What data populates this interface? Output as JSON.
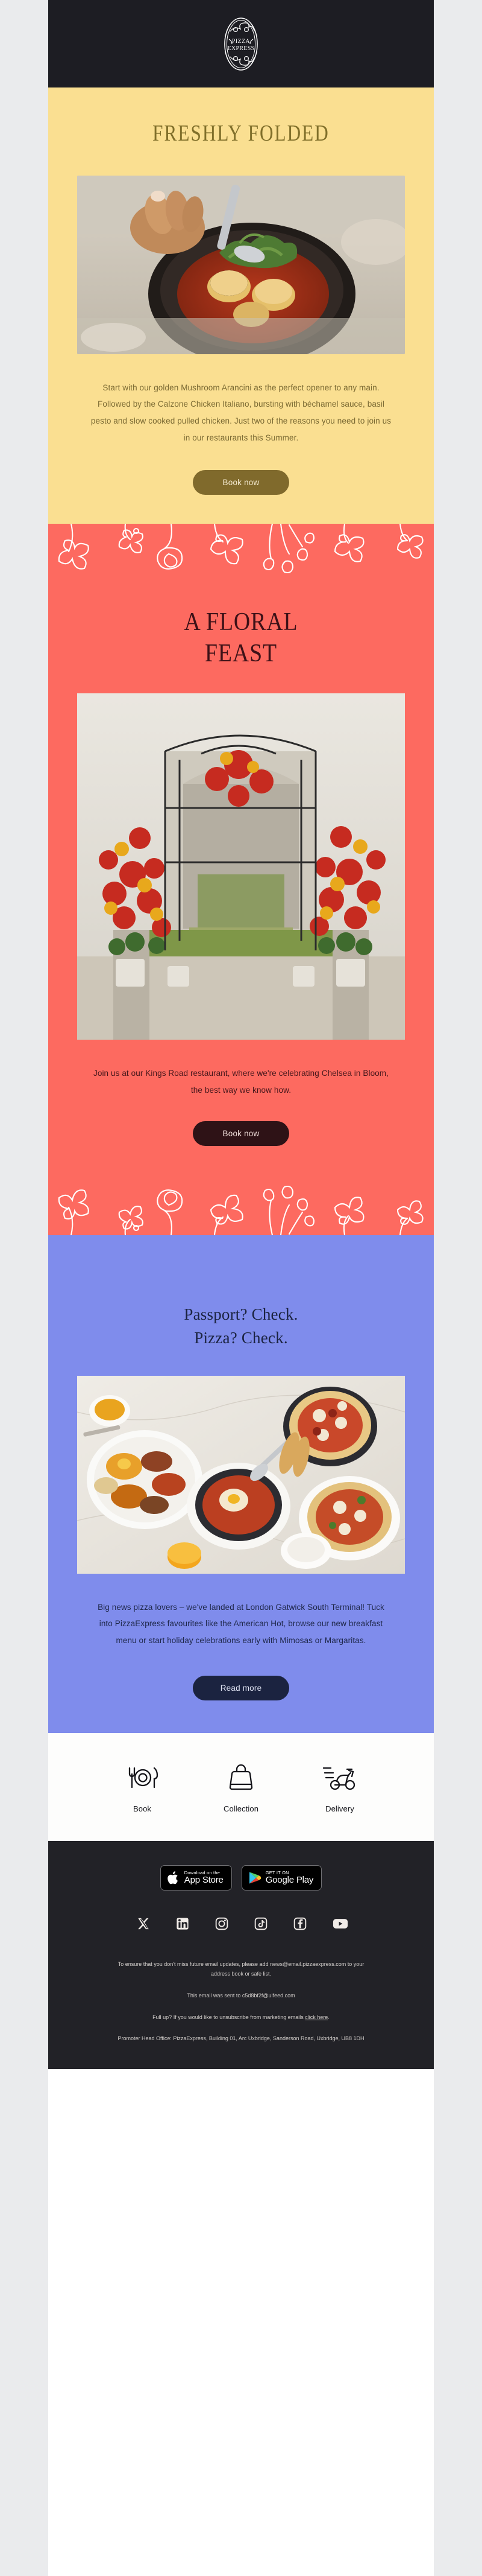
{
  "brand": {
    "name": "PizzaExpress",
    "logo_line_1": "PIZZA",
    "logo_line_2": "EXPRESS",
    "header_bg": "#1d1d23"
  },
  "sections": {
    "freshly_folded": {
      "bg": "#fadf91",
      "accent": "#806f2a",
      "heading": "FRESHLY FOLDED",
      "body": "Start with our golden Mushroom Arancini as the perfect opener to any main. Followed by the Calzone Chicken Italiano, bursting with béchamel sauce, basil pesto and slow cooked pulled chicken. Just two of the reasons you need to join us in our restaurants this Summer.",
      "cta": "Book now",
      "image_alt": "Calzone Chicken Italiano in a black pan being served"
    },
    "floral_feast": {
      "bg": "#fd6a60",
      "accent": "#3d1117",
      "heading_line_1": "A FLORAL",
      "heading_line_2": "FEAST",
      "body": "Join us at our Kings Road restaurant, where we're celebrating Chelsea in Bloom, the best way we know how.",
      "cta": "Book now",
      "image_alt": "Kings Road restaurant entrance decorated with red and yellow flowers"
    },
    "gatwick": {
      "bg": "#7f8cec",
      "accent": "#1b2340",
      "heading_line_1": "Passport? Check.",
      "heading_line_2": "Pizza? Check.",
      "body": "Big news pizza lovers – we've landed at London Gatwick South Terminal! Tuck into PizzaExpress favourites like the American Hot, browse our new breakfast menu or start holiday celebrations early with Mimosas or Margaritas.",
      "cta": "Read more",
      "image_alt": "Breakfast spread with pizzas, full English breakfast and orange juice"
    }
  },
  "services": [
    {
      "icon": "cutlery-plate-icon",
      "label": "Book"
    },
    {
      "icon": "takeaway-bag-icon",
      "label": "Collection"
    },
    {
      "icon": "delivery-scooter-icon",
      "label": "Delivery"
    }
  ],
  "footer": {
    "bg": "#222227",
    "stores": [
      {
        "icon": "apple-icon",
        "top": "Download on the",
        "bottom": "App Store"
      },
      {
        "icon": "google-play-icon",
        "top": "GET IT ON",
        "bottom": "Google Play"
      }
    ],
    "socials": [
      {
        "icon": "x-twitter-icon",
        "label": "X"
      },
      {
        "icon": "linkedin-icon",
        "label": "LinkedIn"
      },
      {
        "icon": "instagram-icon",
        "label": "Instagram"
      },
      {
        "icon": "tiktok-icon",
        "label": "TikTok"
      },
      {
        "icon": "facebook-icon",
        "label": "Facebook"
      },
      {
        "icon": "youtube-icon",
        "label": "YouTube"
      }
    ],
    "legal_1": "To ensure that you don't miss future email updates, please add news@email.pizzaexpress.com to your address book or safe list.",
    "legal_2": "This email was sent to c5d8bf2f@uifeed.com",
    "legal_3_prefix": "Full up? If you would like to unsubscribe from marketing emails ",
    "legal_3_link": "click here",
    "legal_3_suffix": ".",
    "legal_4": "Promoter Head Office: PizzaExpress, Building 01, Arc Uxbridge, Sanderson Road, Uxbridge, UB8 1DH"
  }
}
